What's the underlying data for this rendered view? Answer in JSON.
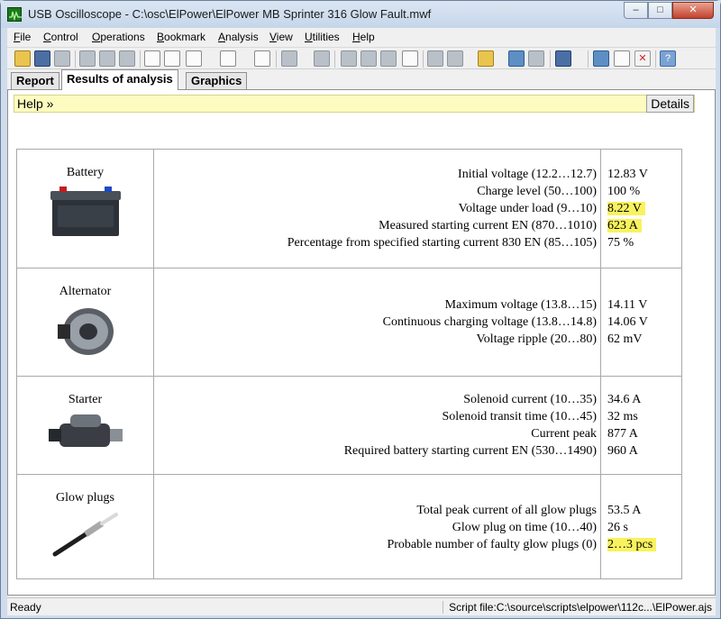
{
  "window": {
    "title": "USB Oscilloscope - C:\\osc\\ElPower\\ElPower MB Sprinter 316 Glow Fault.mwf",
    "minimize": "–",
    "maximize": "□",
    "close": "✕"
  },
  "menu": [
    "File",
    "Control",
    "Operations",
    "Bookmark",
    "Analysis",
    "View",
    "Utilities",
    "Help"
  ],
  "tabs": [
    "Report",
    "Results of analysis",
    "Graphics"
  ],
  "help": {
    "label": "Help »",
    "details": "Details"
  },
  "sections": [
    {
      "name": "Battery",
      "icon": "battery-image",
      "params": [
        {
          "label": "Initial voltage (12.2…12.7)",
          "value": "12.83 V",
          "highlight": false
        },
        {
          "label": "Charge level (50…100)",
          "value": "100 %",
          "highlight": false
        },
        {
          "label": "Voltage under load (9…10)",
          "value": "8.22 V",
          "highlight": true
        },
        {
          "label": "Measured starting current EN (870…1010)",
          "value": "623 A",
          "highlight": true
        },
        {
          "label": "Percentage from specified starting current 830 EN (85…105)",
          "value": "75 %",
          "highlight": false
        }
      ]
    },
    {
      "name": "Alternator",
      "icon": "alternator-image",
      "params": [
        {
          "label": "Maximum voltage (13.8…15)",
          "value": "14.11 V",
          "highlight": false
        },
        {
          "label": "Continuous charging voltage (13.8…14.8)",
          "value": "14.06 V",
          "highlight": false
        },
        {
          "label": "Voltage ripple (20…80)",
          "value": "62 mV",
          "highlight": false
        }
      ]
    },
    {
      "name": "Starter",
      "icon": "starter-image",
      "params": [
        {
          "label": "Solenoid current (10…35)",
          "value": "34.6 A",
          "highlight": false
        },
        {
          "label": "Solenoid transit time (10…45)",
          "value": "32 ms",
          "highlight": false
        },
        {
          "label": "Current peak",
          "value": "877 A",
          "highlight": false
        },
        {
          "label": "Required battery starting current EN (530…1490)",
          "value": "960 A",
          "highlight": false
        }
      ]
    },
    {
      "name": "Glow plugs",
      "icon": "glow-plug-image",
      "params": [
        {
          "label": "Total peak current of all glow plugs",
          "value": "53.5 A",
          "highlight": false
        },
        {
          "label": "Glow plug on time (10…40)",
          "value": "26 s",
          "highlight": false
        },
        {
          "label": "Probable number of faulty glow plugs (0)",
          "value": "2…3 pcs",
          "highlight": true
        }
      ]
    }
  ],
  "status": {
    "left": "Ready",
    "right": "Script file:C:\\source\\scripts\\elpower\\112c...\\ElPower.ajs"
  },
  "colors": {
    "highlight": "#f9f25f",
    "helpbar": "#fdfbbf"
  }
}
